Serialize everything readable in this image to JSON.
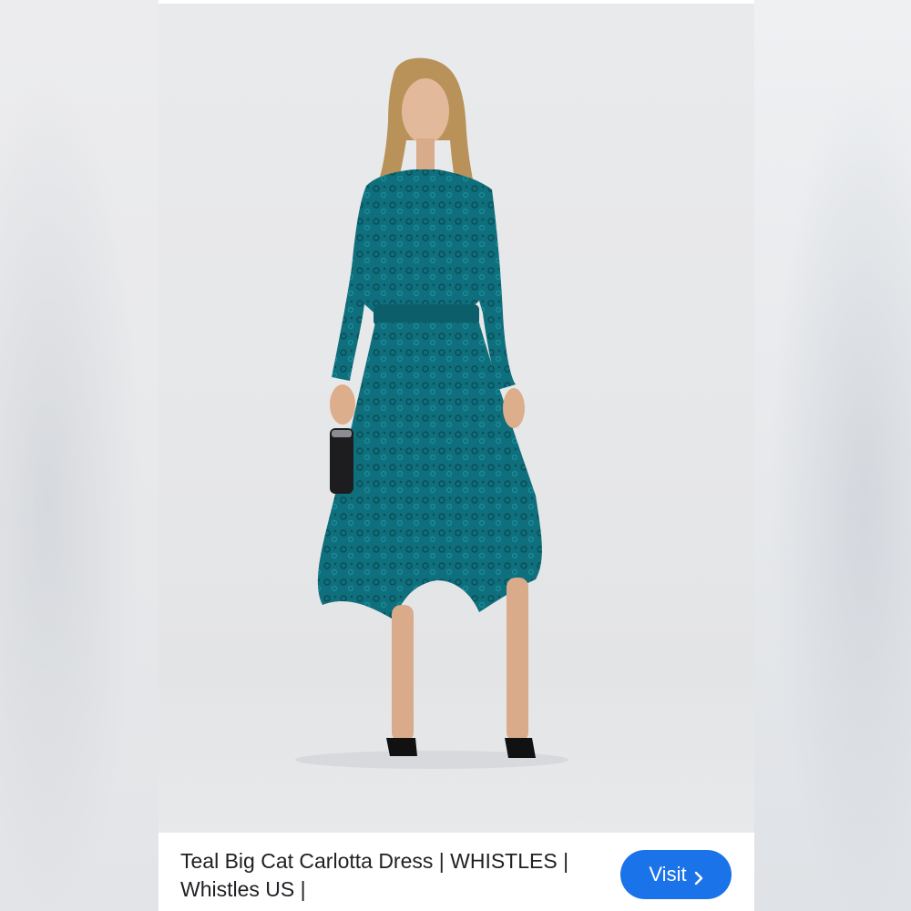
{
  "product": {
    "image_subject": "woman in teal dress",
    "caption": "Teal Big Cat Carlotta Dress | WHISTLES | Whistles US |"
  },
  "actions": {
    "visit_label": "Visit",
    "visit_icon": "chevron-right-icon"
  },
  "colors": {
    "dress_teal": "#0e6b78",
    "button_blue": "#1a73e8",
    "caption_text": "#202124"
  }
}
